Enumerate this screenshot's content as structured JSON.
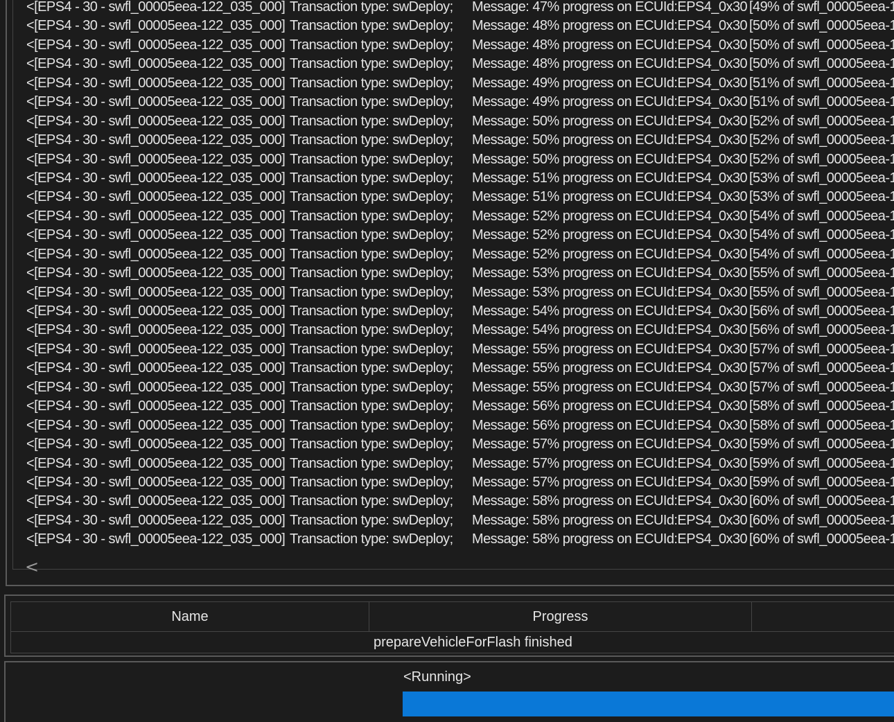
{
  "log": {
    "lines": [
      [
        "<[EPS4 - 30 - swfl_00005eea-122_035_000]",
        "Transaction type: swDeploy;",
        "Message: 47% progress on ECUId:EPS4_0x30",
        "[49% of swfl_00005eea-1"
      ],
      [
        "<[EPS4 - 30 - swfl_00005eea-122_035_000]",
        "Transaction type: swDeploy;",
        "Message: 48% progress on ECUId:EPS4_0x30",
        "[50% of swfl_00005eea-1"
      ],
      [
        "<[EPS4 - 30 - swfl_00005eea-122_035_000]",
        "Transaction type: swDeploy;",
        "Message: 48% progress on ECUId:EPS4_0x30",
        "[50% of swfl_00005eea-1"
      ],
      [
        "<[EPS4 - 30 - swfl_00005eea-122_035_000]",
        "Transaction type: swDeploy;",
        "Message: 48% progress on ECUId:EPS4_0x30",
        "[50% of swfl_00005eea-1"
      ],
      [
        "<[EPS4 - 30 - swfl_00005eea-122_035_000]",
        "Transaction type: swDeploy;",
        "Message: 49% progress on ECUId:EPS4_0x30",
        "[51% of swfl_00005eea-1"
      ],
      [
        "<[EPS4 - 30 - swfl_00005eea-122_035_000]",
        "Transaction type: swDeploy;",
        "Message: 49% progress on ECUId:EPS4_0x30",
        "[51% of swfl_00005eea-1"
      ],
      [
        "<[EPS4 - 30 - swfl_00005eea-122_035_000]",
        "Transaction type: swDeploy;",
        "Message: 50% progress on ECUId:EPS4_0x30",
        "[52% of swfl_00005eea-1"
      ],
      [
        "<[EPS4 - 30 - swfl_00005eea-122_035_000]",
        "Transaction type: swDeploy;",
        "Message: 50% progress on ECUId:EPS4_0x30",
        "[52% of swfl_00005eea-1"
      ],
      [
        "<[EPS4 - 30 - swfl_00005eea-122_035_000]",
        "Transaction type: swDeploy;",
        "Message: 50% progress on ECUId:EPS4_0x30",
        "[52% of swfl_00005eea-1"
      ],
      [
        "<[EPS4 - 30 - swfl_00005eea-122_035_000]",
        "Transaction type: swDeploy;",
        "Message: 51% progress on ECUId:EPS4_0x30",
        "[53% of swfl_00005eea-1"
      ],
      [
        "<[EPS4 - 30 - swfl_00005eea-122_035_000]",
        "Transaction type: swDeploy;",
        "Message: 51% progress on ECUId:EPS4_0x30",
        "[53% of swfl_00005eea-1"
      ],
      [
        "<[EPS4 - 30 - swfl_00005eea-122_035_000]",
        "Transaction type: swDeploy;",
        "Message: 52% progress on ECUId:EPS4_0x30",
        "[54% of swfl_00005eea-1"
      ],
      [
        "<[EPS4 - 30 - swfl_00005eea-122_035_000]",
        "Transaction type: swDeploy;",
        "Message: 52% progress on ECUId:EPS4_0x30",
        "[54% of swfl_00005eea-1"
      ],
      [
        "<[EPS4 - 30 - swfl_00005eea-122_035_000]",
        "Transaction type: swDeploy;",
        "Message: 52% progress on ECUId:EPS4_0x30",
        "[54% of swfl_00005eea-1"
      ],
      [
        "<[EPS4 - 30 - swfl_00005eea-122_035_000]",
        "Transaction type: swDeploy;",
        "Message: 53% progress on ECUId:EPS4_0x30",
        "[55% of swfl_00005eea-1"
      ],
      [
        "<[EPS4 - 30 - swfl_00005eea-122_035_000]",
        "Transaction type: swDeploy;",
        "Message: 53% progress on ECUId:EPS4_0x30",
        "[55% of swfl_00005eea-1"
      ],
      [
        "<[EPS4 - 30 - swfl_00005eea-122_035_000]",
        "Transaction type: swDeploy;",
        "Message: 54% progress on ECUId:EPS4_0x30",
        "[56% of swfl_00005eea-1"
      ],
      [
        "<[EPS4 - 30 - swfl_00005eea-122_035_000]",
        "Transaction type: swDeploy;",
        "Message: 54% progress on ECUId:EPS4_0x30",
        "[56% of swfl_00005eea-1"
      ],
      [
        "<[EPS4 - 30 - swfl_00005eea-122_035_000]",
        "Transaction type: swDeploy;",
        "Message: 55% progress on ECUId:EPS4_0x30",
        "[57% of swfl_00005eea-1"
      ],
      [
        "<[EPS4 - 30 - swfl_00005eea-122_035_000]",
        "Transaction type: swDeploy;",
        "Message: 55% progress on ECUId:EPS4_0x30",
        "[57% of swfl_00005eea-1"
      ],
      [
        "<[EPS4 - 30 - swfl_00005eea-122_035_000]",
        "Transaction type: swDeploy;",
        "Message: 55% progress on ECUId:EPS4_0x30",
        "[57% of swfl_00005eea-1"
      ],
      [
        "<[EPS4 - 30 - swfl_00005eea-122_035_000]",
        "Transaction type: swDeploy;",
        "Message: 56% progress on ECUId:EPS4_0x30",
        "[58% of swfl_00005eea-1"
      ],
      [
        "<[EPS4 - 30 - swfl_00005eea-122_035_000]",
        "Transaction type: swDeploy;",
        "Message: 56% progress on ECUId:EPS4_0x30",
        "[58% of swfl_00005eea-1"
      ],
      [
        "<[EPS4 - 30 - swfl_00005eea-122_035_000]",
        "Transaction type: swDeploy;",
        "Message: 57% progress on ECUId:EPS4_0x30",
        "[59% of swfl_00005eea-1"
      ],
      [
        "<[EPS4 - 30 - swfl_00005eea-122_035_000]",
        "Transaction type: swDeploy;",
        "Message: 57% progress on ECUId:EPS4_0x30",
        "[59% of swfl_00005eea-1"
      ],
      [
        "<[EPS4 - 30 - swfl_00005eea-122_035_000]",
        "Transaction type: swDeploy;",
        "Message: 57% progress on ECUId:EPS4_0x30",
        "[59% of swfl_00005eea-1"
      ],
      [
        "<[EPS4 - 30 - swfl_00005eea-122_035_000]",
        "Transaction type: swDeploy;",
        "Message: 58% progress on ECUId:EPS4_0x30",
        "[60% of swfl_00005eea-1"
      ],
      [
        "<[EPS4 - 30 - swfl_00005eea-122_035_000]",
        "Transaction type: swDeploy;",
        "Message: 58% progress on ECUId:EPS4_0x30",
        "[60% of swfl_00005eea-1"
      ],
      [
        "<[EPS4 - 30 - swfl_00005eea-122_035_000]",
        "Transaction type: swDeploy;",
        "Message: 58% progress on ECUId:EPS4_0x30",
        "[60% of swfl_00005eea-1"
      ]
    ],
    "scroll_left_glyph": "<"
  },
  "task_table": {
    "columns": [
      "Name",
      "Progress",
      ""
    ],
    "rows": [
      {
        "text": "prepareVehicleForFlash finished"
      }
    ]
  },
  "status": {
    "label": "<Running>",
    "progress_fraction": 1.0,
    "bar_color": "#0a78d7"
  }
}
